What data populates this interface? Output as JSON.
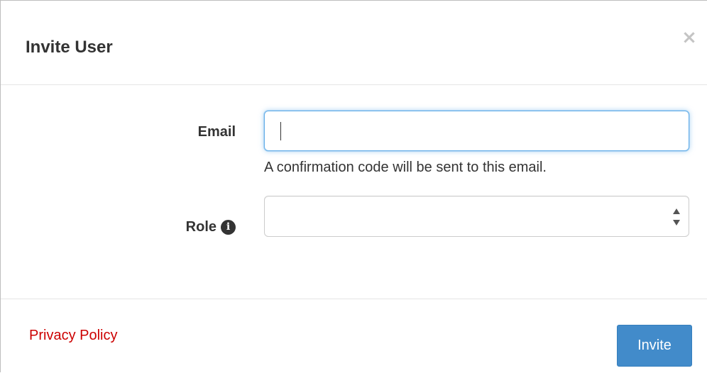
{
  "modal": {
    "title": "Invite User",
    "close_label": "×"
  },
  "form": {
    "email": {
      "label": "Email",
      "value": "",
      "placeholder": "",
      "help_text": "A confirmation code will be sent to this email."
    },
    "role": {
      "label": "Role",
      "info_icon": "i",
      "selected_value": ""
    }
  },
  "footer": {
    "privacy_link": "Privacy Policy",
    "invite_button": "Invite"
  },
  "colors": {
    "accent": "#428bca",
    "link": "#cc0000",
    "focus": "#66afe9"
  }
}
